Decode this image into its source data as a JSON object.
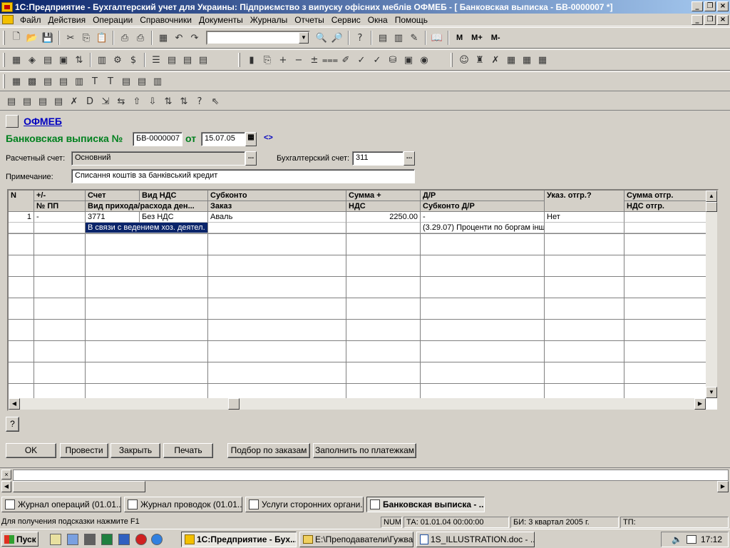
{
  "window": {
    "title": "1С:Предприятие - Бухгалтерский учет для Украины: Підприємство з випуску офісних меблів ОФМЕБ - [ Банковская выписка - БВ-0000007 *]"
  },
  "menu": [
    "Файл",
    "Действия",
    "Операции",
    "Справочники",
    "Документы",
    "Журналы",
    "Отчеты",
    "Сервис",
    "Окна",
    "Помощь"
  ],
  "toolbar": {
    "m_label": "M",
    "mplus_label": "M+",
    "mminus_label": "M-"
  },
  "form": {
    "org_link": "ОФМЕБ",
    "doc_title": "Банковская выписка №",
    "doc_number": "БВ-0000007",
    "from_label": "от",
    "doc_date": "15.07.05",
    "nav_arrows": "<>",
    "account_label": "Расчетный счет:",
    "account_value": "Основний",
    "acc_account_label": "Бухгалтерский счет:",
    "acc_account_value": "311",
    "note_label": "Примечание:",
    "note_value": "Списання коштів за банківський кредит",
    "dots": "..."
  },
  "grid": {
    "headers_top": [
      "N",
      "+/-",
      "Счет",
      "Вид НДС",
      "Субконто",
      "Сумма +",
      "Д/Р",
      "Указ. отгр.?",
      "Сумма отгр."
    ],
    "headers_bottom": [
      "",
      "№ ПП",
      "Вид прихода/расхода ден...",
      "",
      "Заказ",
      "НДС",
      "Субконто Д/Р",
      "",
      "НДС отгр."
    ],
    "rows": [
      {
        "n": "1",
        "sign": "-",
        "account": "3771",
        "vat_type": "Без НДС",
        "subconto": "Аваль",
        "sum_plus": "2250.00",
        "dr": "-",
        "shipment_flag": "Нет",
        "shipment_sum": "",
        "pp_number": "",
        "movement_type": "В связи с ведением хоз. деятел.",
        "order": "",
        "vat": "",
        "dr_subconto": "(3.29.07) Проценти по боргам інш",
        "shipment_vat": ""
      }
    ]
  },
  "buttons": {
    "help": "?",
    "ok": "OK",
    "post": "Провести",
    "close": "Закрыть",
    "print": "Печать",
    "select_orders": "Подбор по заказам",
    "fill_payments": "Заполнить по платежкам"
  },
  "window_tabs": [
    {
      "label": "Журнал операций (01.01....",
      "active": false
    },
    {
      "label": "Журнал проводок (01.01....",
      "active": false
    },
    {
      "label": "Услуги сторонних органи...",
      "active": false
    },
    {
      "label": "Банковская выписка - ...",
      "active": true
    }
  ],
  "status": {
    "hint": "Для получения подсказки нажмите F1",
    "num": "NUM",
    "ta": "ТА: 01.01.04  00:00:00",
    "bi": "БИ: 3 квартал 2005 г.",
    "tp": "ТП:"
  },
  "taskbar": {
    "start_label": "Пуск",
    "tasks": [
      {
        "label": "1С:Предприятие - Бух...",
        "active": true
      },
      {
        "label": "E:\\Преподаватели\\Гужва",
        "active": false
      },
      {
        "label": "1S_ILLUSTRATION.doc - ...",
        "active": false
      }
    ],
    "clock": "17:12"
  }
}
